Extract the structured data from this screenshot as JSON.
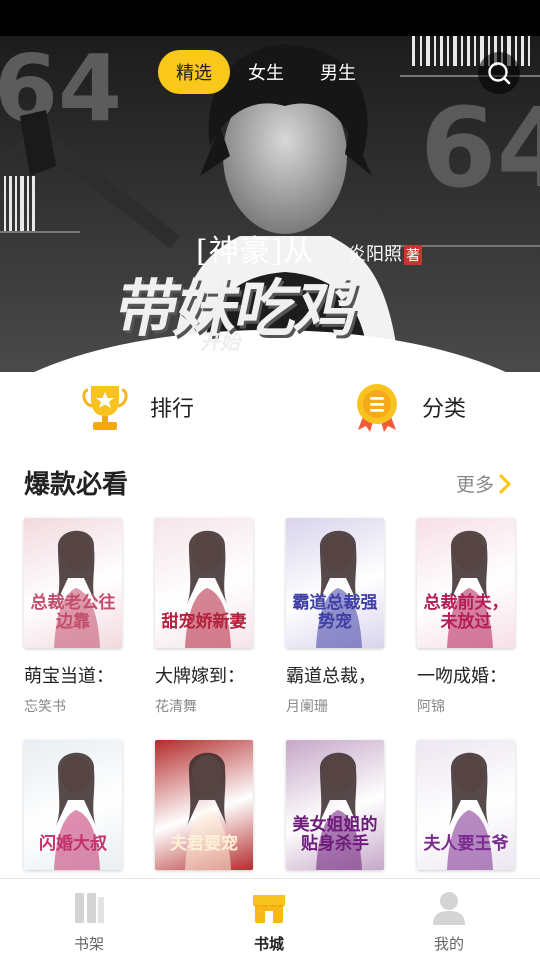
{
  "header": {
    "tabs": [
      {
        "label": "精选",
        "active": true
      },
      {
        "label": "女生",
        "active": false
      },
      {
        "label": "男生",
        "active": false
      }
    ],
    "search_icon": "search-icon"
  },
  "banner": {
    "title_line1": "[神豪]从",
    "author": "炎阳照",
    "author_tag": "著",
    "title_line2": "带妹吃鸡",
    "title_line3": "开始",
    "background_numbers": [
      "64",
      "64"
    ]
  },
  "entries": [
    {
      "label": "排行",
      "icon": "trophy-icon",
      "color": "#f7b51e"
    },
    {
      "label": "分类",
      "icon": "medal-icon",
      "color": "#f7b51e"
    }
  ],
  "section": {
    "title": "爆款必看",
    "more_label": "更多",
    "accent": "#f9c81a"
  },
  "books": [
    {
      "title": "萌宝当道：",
      "author": "忘笑书",
      "cover_text": "总裁老公往边靠",
      "cover_bg": "#f2d9df",
      "cover_fg": "#c24d6c"
    },
    {
      "title": "大牌嫁到：",
      "author": "花清舞",
      "cover_text": "甜宠娇新妻",
      "cover_bg": "#f5e4e8",
      "cover_fg": "#b3213c"
    },
    {
      "title": "霸道总裁，",
      "author": "月阑珊",
      "cover_text": "霸道总裁强势宠",
      "cover_bg": "#d9d3ec",
      "cover_fg": "#3f3fa5"
    },
    {
      "title": "一吻成婚：",
      "author": "阿锦",
      "cover_text": "总裁前夫，未放过",
      "cover_bg": "#f7dfe6",
      "cover_fg": "#b51d57"
    },
    {
      "title": "",
      "author": "",
      "cover_text": "闪婚大叔",
      "cover_bg": "#e8eef2",
      "cover_fg": "#c2326b"
    },
    {
      "title": "",
      "author": "",
      "cover_text": "夫君要宠",
      "cover_bg": "#b32b2b",
      "cover_fg": "#fff0d8"
    },
    {
      "title": "",
      "author": "",
      "cover_text": "美女姐姐的贴身杀手",
      "cover_bg": "#c6a7c8",
      "cover_fg": "#6d1b7b"
    },
    {
      "title": "",
      "author": "",
      "cover_text": "夫人要王爷",
      "cover_bg": "#ece6f0",
      "cover_fg": "#7b2b8f"
    }
  ],
  "bottom_nav": [
    {
      "label": "书架",
      "icon": "bookshelf-icon",
      "active": false
    },
    {
      "label": "书城",
      "icon": "bookstore-icon",
      "active": true
    },
    {
      "label": "我的",
      "icon": "profile-icon",
      "active": false
    }
  ]
}
